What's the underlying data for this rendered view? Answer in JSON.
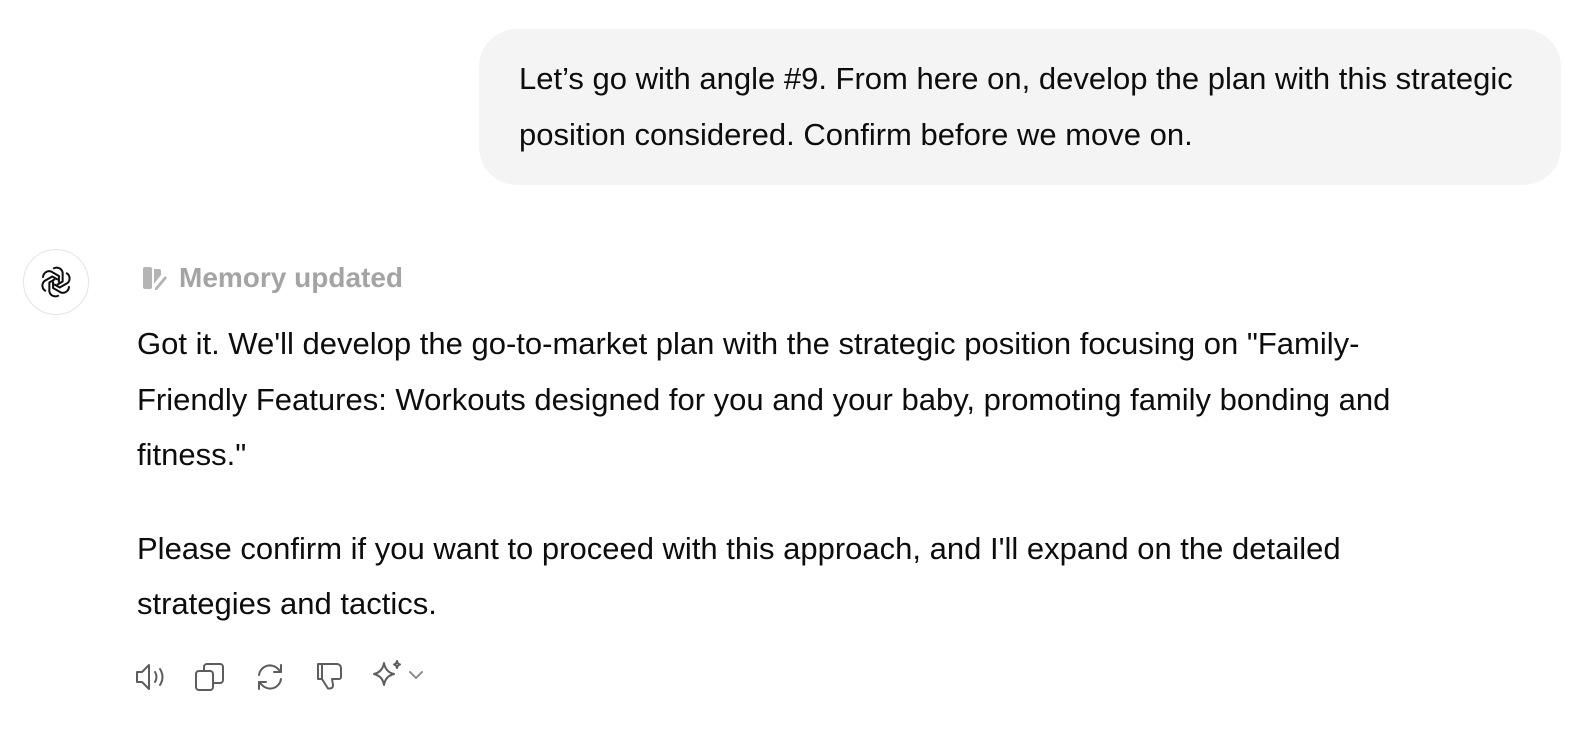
{
  "user_message": {
    "text": "Let’s go with angle #9. From here on, develop the plan with this strategic position considered. Confirm before we move on."
  },
  "assistant": {
    "avatar_icon": "openai-logo-icon",
    "memory_status": "Memory updated",
    "paragraphs": [
      "Got it. We'll develop the go-to-market plan with the strategic position focusing on \"Family-Friendly Features: Workouts designed for you and your baby, promoting family bonding and fitness.\"",
      "Please confirm if you want to proceed with this approach, and I'll expand on the detailed strategies and tactics."
    ]
  },
  "actions": {
    "icons": [
      "read-aloud-icon",
      "copy-icon",
      "regenerate-icon",
      "thumbs-down-icon",
      "sparkle-icon",
      "chevron-down-icon"
    ]
  },
  "colors": {
    "user_bubble_bg": "#f4f4f4",
    "memory_text": "#a4a4a4",
    "icon_stroke": "#5d5d5d",
    "text": "#0d0d0d"
  }
}
